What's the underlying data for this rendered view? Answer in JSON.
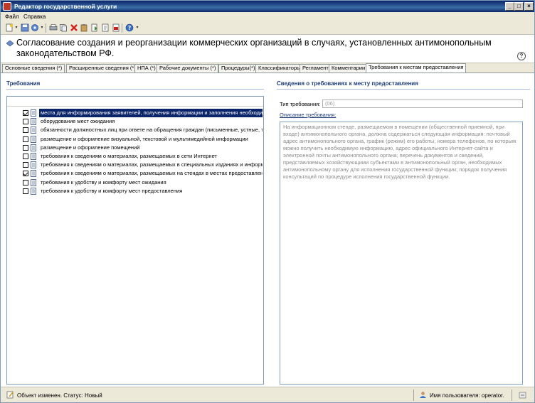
{
  "window": {
    "title": "Редактор государственной услуги",
    "minimize_glyph": "_",
    "maximize_glyph": "□",
    "close_glyph": "×"
  },
  "menu": {
    "file": "Файл",
    "help": "Справка"
  },
  "toolbar": {
    "icons": [
      "new-document-icon",
      "save-icon",
      "settings-icon",
      "print-icon",
      "copy-icon",
      "delete-icon",
      "paste-icon",
      "import-icon",
      "export-pdf-icon",
      "help-icon"
    ]
  },
  "header": {
    "title": "Согласование создания и реорганизации коммерческих организаций в случаях, установленных антимонопольным законодательством РФ.",
    "help_glyph": "?"
  },
  "tabs": [
    {
      "label": "Основные сведения (*)",
      "active": false
    },
    {
      "label": "Расширенные сведения (*)",
      "active": false
    },
    {
      "label": "НПА (*)",
      "active": false
    },
    {
      "label": "Рабочие документы (*)",
      "active": false
    },
    {
      "label": "Процедуры(*)",
      "active": false
    },
    {
      "label": "Классификаторы",
      "active": false
    },
    {
      "label": "Регламент",
      "active": false
    },
    {
      "label": "Комментарии",
      "active": false
    },
    {
      "label": "Требования к местам предоставления",
      "active": true
    }
  ],
  "requirements_panel": {
    "title": "Требования",
    "items": [
      {
        "label": "места для информирования заявителей, получения информации и заполнения необходимых документов",
        "checked": true,
        "selected": true
      },
      {
        "label": "оборудование мест ожидания",
        "checked": false,
        "selected": false
      },
      {
        "label": "обязанности должностных лиц при ответе на обращения граждан (письменные, устные, телефонные)",
        "checked": false,
        "selected": false
      },
      {
        "label": "размещение и оформление визуальной, текстовой и мультимедийной информации",
        "checked": false,
        "selected": false
      },
      {
        "label": "размещение и оформление помещений",
        "checked": false,
        "selected": false
      },
      {
        "label": "требования к сведениям о материалах, размещаемых в сети Интернет",
        "checked": false,
        "selected": false
      },
      {
        "label": "требования к сведениям о материалах, размещаемых в специальных изданиях и информационных материалах",
        "checked": false,
        "selected": false
      },
      {
        "label": "требования к сведениям о материалах, размещаемых на стендах в местах предоставления услуги",
        "checked": true,
        "selected": false
      },
      {
        "label": "требования к удобству и комфорту мест ожидания",
        "checked": false,
        "selected": false
      },
      {
        "label": "требования к удобству и комфорту мест предоставления",
        "checked": false,
        "selected": false
      }
    ]
  },
  "details_panel": {
    "title": "Сведения о требованиях к месту предоставления",
    "type_label": "Тип требования:",
    "type_value": "(06)",
    "description_label": "Описание требования:",
    "description_text": "На информационном стенде, размещаемом в помещении (общественной приемной, при входе) антимонопольного органа, должна содержаться следующая информация: почтовый адрес антимонопольного органа, график (режим) его работы, номера телефонов, по которым можно получить необходимую информацию, адрес официального Интернет-сайта и электронной почты антимонопольного органа; перечень документов и сведений, представляемых хозяйствующими субъектами в антимонопольный орган, необходимых антимонопольному органу для исполнения государственной функции; порядок получения консультаций по процедуре исполнения государственной функции."
  },
  "statusbar": {
    "status": "Объект изменен. Статус: Новый",
    "user": "Имя пользователя: operator."
  }
}
